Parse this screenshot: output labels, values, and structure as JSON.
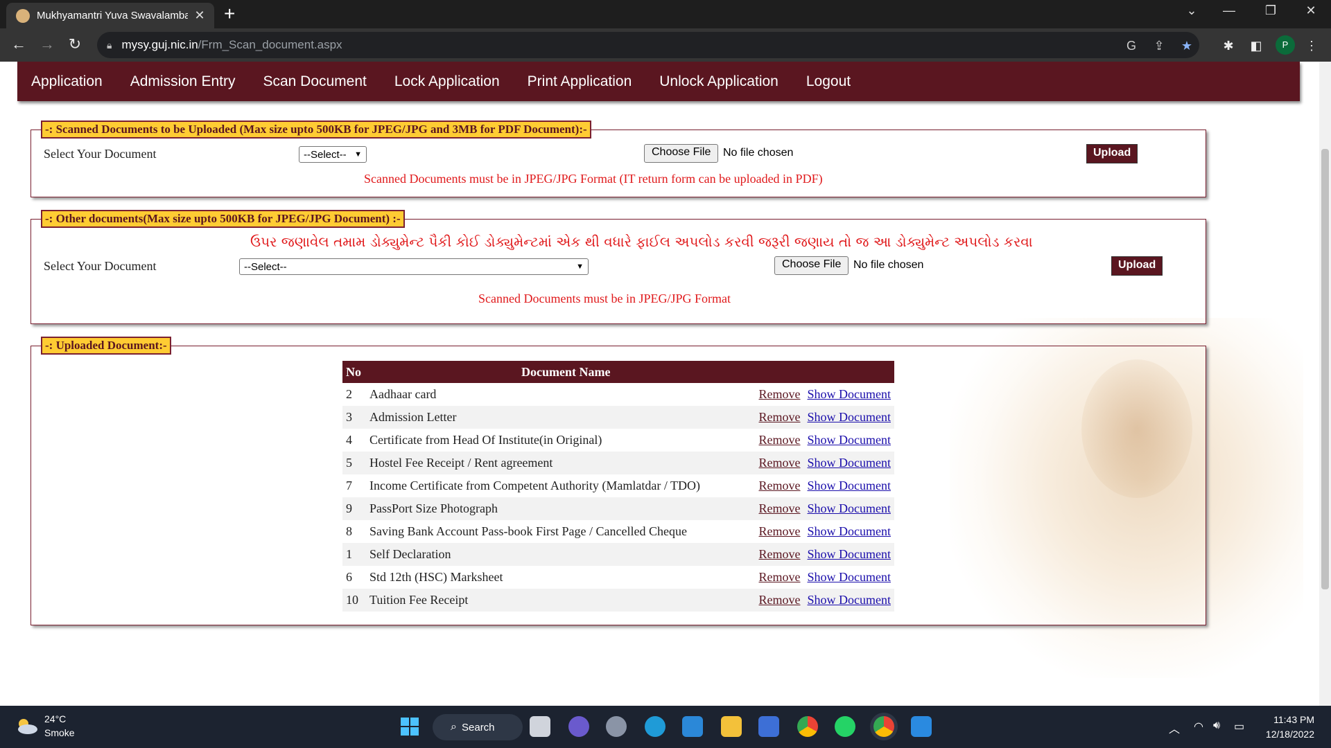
{
  "browser": {
    "tab_title": "Mukhyamantri Yuva Swavalamba",
    "tab_close": "✕",
    "new_tab": "+",
    "url_host": "mysy.guj.nic.in",
    "url_path": "/Frm_Scan_document.aspx",
    "profile_initial": "P"
  },
  "menu": {
    "items": [
      "Application",
      "Admission Entry",
      "Scan Document",
      "Lock Application",
      "Print Application",
      "Unlock Application",
      "Logout"
    ]
  },
  "scanned_section": {
    "legend": "-: Scanned Documents to be Uploaded (Max size upto 500KB for JPEG/JPG and 3MB for PDF Document):-",
    "select_label": "Select Your Document",
    "select_value": "--Select--",
    "choose_file": "Choose File",
    "file_status": "No file chosen",
    "upload": "Upload",
    "note": "Scanned Documents must be in JPEG/JPG Format (IT return form can be uploaded in PDF)"
  },
  "other_section": {
    "legend": "-: Other documents(Max size upto 500KB for JPEG/JPG Document) :-",
    "gujarati_note": "ઉપર જણાવેલ તમામ ડોક્યુમેન્ટ પૈકી કોઈ ડોક્યુમેન્ટમાં એક થી વધારે ફાઈલ અપલોડ કરવી જરૂરી જણાય તો જ આ ડોક્યુમેન્ટ અપલોડ કરવા",
    "select_label": "Select Your Document",
    "select_value": "--Select--",
    "choose_file": "Choose File",
    "file_status": "No file chosen",
    "upload": "Upload",
    "note": "Scanned Documents must be in JPEG/JPG Format"
  },
  "uploaded_section": {
    "legend": "-: Uploaded Document:-",
    "columns": [
      "No",
      "Document Name"
    ],
    "remove_label": "Remove",
    "show_label": "Show Document",
    "rows": [
      {
        "no": "2",
        "name": "Aadhaar card"
      },
      {
        "no": "3",
        "name": "Admission Letter"
      },
      {
        "no": "4",
        "name": "Certificate from Head Of Institute(in Original)"
      },
      {
        "no": "5",
        "name": "Hostel Fee Receipt / Rent agreement"
      },
      {
        "no": "7",
        "name": "Income Certificate from Competent Authority (Mamlatdar / TDO)"
      },
      {
        "no": "9",
        "name": "PassPort Size Photograph"
      },
      {
        "no": "8",
        "name": "Saving Bank Account Pass-book First Page / Cancelled Cheque"
      },
      {
        "no": "1",
        "name": "Self Declaration"
      },
      {
        "no": "6",
        "name": "Std 12th (HSC) Marksheet"
      },
      {
        "no": "10",
        "name": "Tuition Fee Receipt"
      }
    ]
  },
  "taskbar": {
    "temperature": "24°C",
    "weather": "Smoke",
    "search": "Search",
    "time": "11:43 PM",
    "date": "12/18/2022"
  },
  "colors": {
    "maroon": "#5a1620",
    "legend_yellow": "#ffcc33",
    "note_red": "#e0191b",
    "link_blue": "#1a0dab"
  }
}
